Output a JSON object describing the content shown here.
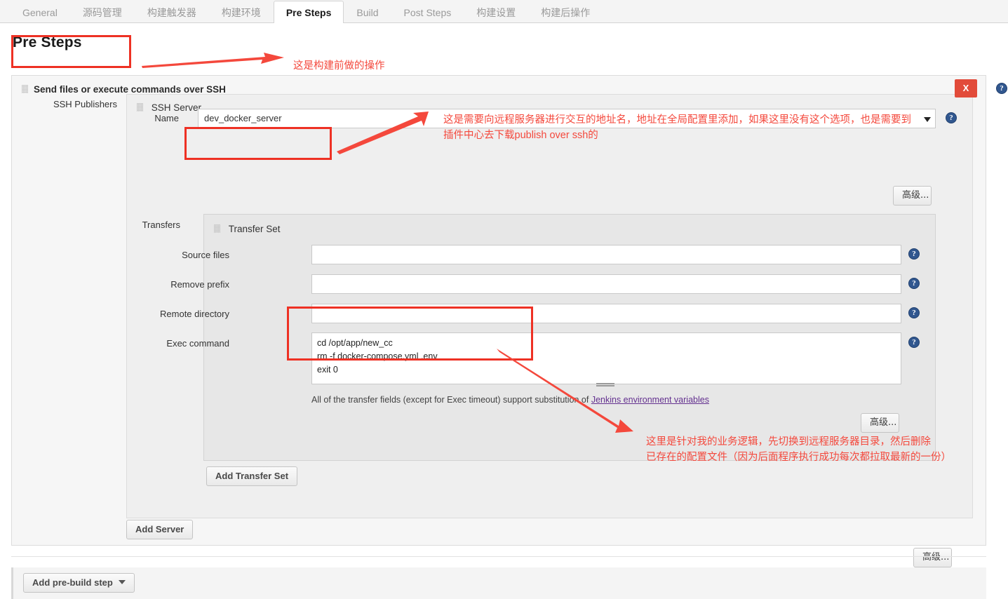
{
  "tabs": [
    {
      "label": "General",
      "active": false
    },
    {
      "label": "源码管理",
      "active": false
    },
    {
      "label": "构建触发器",
      "active": false
    },
    {
      "label": "构建环境",
      "active": false
    },
    {
      "label": "Pre Steps",
      "active": true
    },
    {
      "label": "Build",
      "active": false
    },
    {
      "label": "Post Steps",
      "active": false
    },
    {
      "label": "构建设置",
      "active": false
    },
    {
      "label": "构建后操作",
      "active": false
    }
  ],
  "page": {
    "title": "Pre Steps"
  },
  "builder": {
    "title": "Send files or execute commands over SSH",
    "delete_label": "X",
    "help_glyph": "?",
    "publishers_label": "SSH Publishers",
    "ssh_server": {
      "section_label": "SSH Server",
      "name_label": "Name",
      "name_value": "dev_docker_server",
      "advanced_label": "高级..."
    },
    "transfers": {
      "label": "Transfers",
      "set_label": "Transfer Set",
      "fields": [
        {
          "label": "Source files",
          "value": ""
        },
        {
          "label": "Remove prefix",
          "value": ""
        },
        {
          "label": "Remote directory",
          "value": ""
        }
      ],
      "exec": {
        "label": "Exec command",
        "value": "cd /opt/app/new_cc\nrm -f docker-compose.yml .env\nexit 0"
      },
      "hint_prefix": "All of the transfer fields (except for Exec timeout) support substitution of ",
      "hint_link": "Jenkins environment variables",
      "advanced_label": "高级...",
      "add_transfer_set_label": "Add Transfer Set"
    },
    "add_server_label": "Add Server",
    "outer_advanced_label": "高级..."
  },
  "footer": {
    "add_prebuild_step_label": "Add pre-build step"
  },
  "annotations": {
    "top": "这是构建前做的操作",
    "server_line1": "这是需要向远程服务器进行交互的地址名，地址在全局配置里添加，如果这里没有这个选项，也是需要到",
    "server_line2": "插件中心去下载publish over ssh的",
    "exec_line1": "这里是针对我的业务逻辑，先切换到远程服务器目录，然后删除",
    "exec_line2": "已存在的配置文件（因为后面程序执行成功每次都拉取最新的一份）"
  },
  "colors": {
    "annotation_red": "#f4483c",
    "box_red": "#ee3124",
    "delete_red": "#e24b3a",
    "help_blue": "#31578f",
    "link_purple": "#63308f"
  }
}
